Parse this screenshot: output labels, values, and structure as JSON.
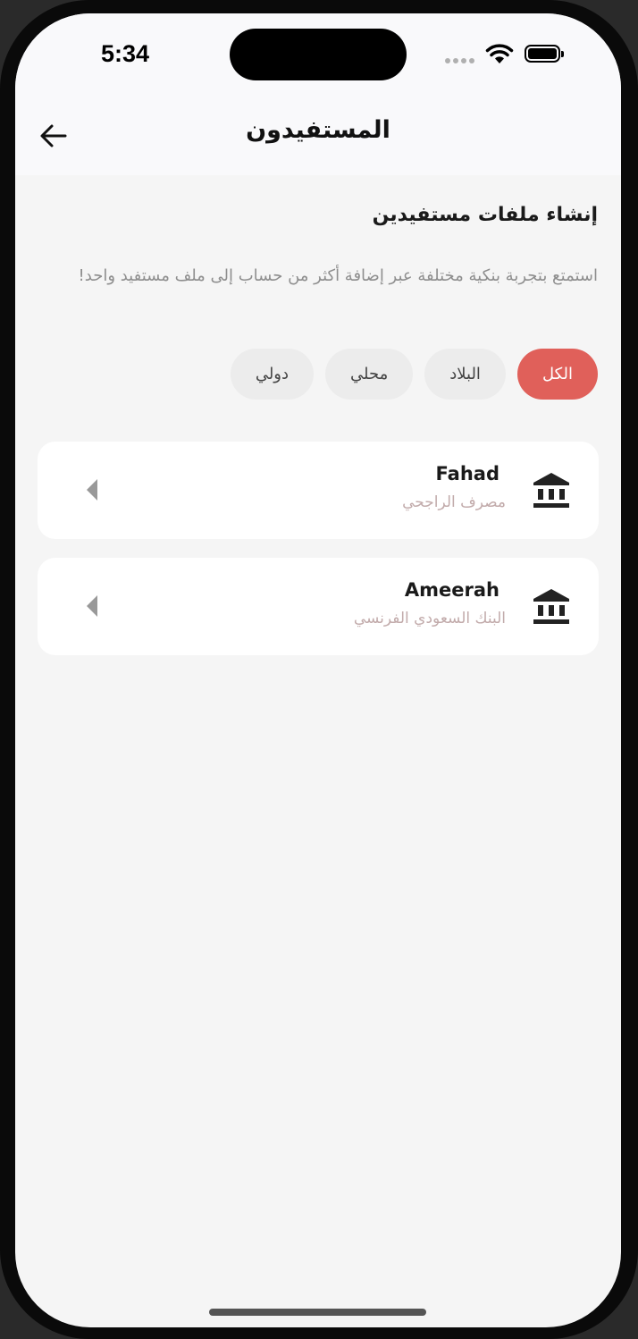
{
  "status_bar": {
    "time": "5:34"
  },
  "header": {
    "title": "المستفيدون",
    "back_icon": "arrow-left-icon"
  },
  "section": {
    "heading": "إنشاء ملفات مستفيدين",
    "description": "استمتع بتجربة بنكية مختلفة عبر إضافة أكثر من حساب إلى ملف مستفيد واحد!"
  },
  "filters": [
    {
      "label": "الكل",
      "active": true
    },
    {
      "label": "البلاد",
      "active": false
    },
    {
      "label": "محلي",
      "active": false
    },
    {
      "label": "دولي",
      "active": false
    }
  ],
  "beneficiaries": [
    {
      "name": "Fahad",
      "bank": "مصرف الراجحي",
      "icon": "bank-icon"
    },
    {
      "name": "Ameerah",
      "bank": "البنك السعودي الفرنسي",
      "icon": "bank-icon"
    }
  ],
  "colors": {
    "accent": "#e0605a",
    "chip_bg": "#ececec",
    "bank_text": "#c2abab"
  }
}
